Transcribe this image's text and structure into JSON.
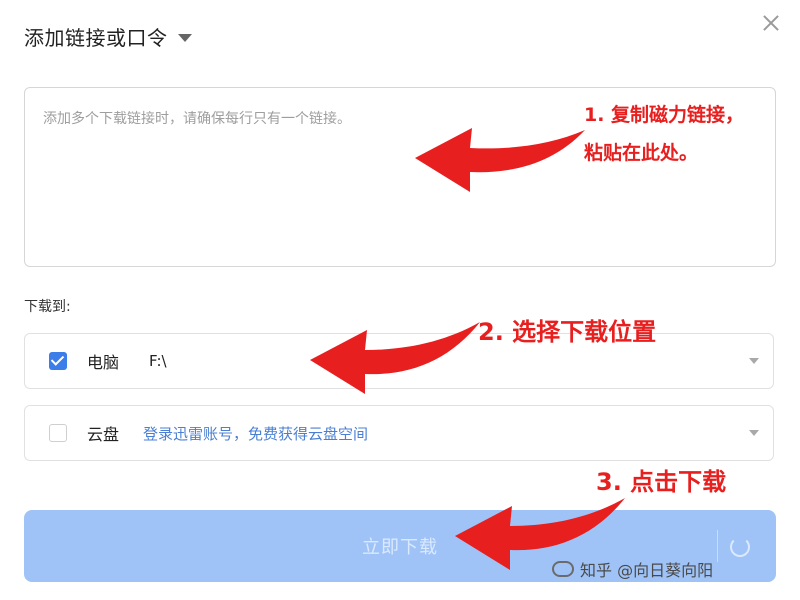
{
  "dialog": {
    "title": "添加链接或口令",
    "textarea_placeholder": "添加多个下载链接时，请确保每行只有一个链接。",
    "download_to_label": "下载到:",
    "pc": {
      "label": "电脑",
      "path": "F:\\",
      "checked": true
    },
    "cloud": {
      "label": "云盘",
      "link_text": "登录迅雷账号，免费获得云盘空间",
      "checked": false
    },
    "download_button_label": "立即下载"
  },
  "annotations": {
    "step1_line1": "1. 复制磁力链接，",
    "step1_line2": "粘贴在此处。",
    "step2": "2. 选择下载位置",
    "step3": "3. 点击下载",
    "color": "#e81f1f"
  },
  "watermark": {
    "text": "知乎 @向日葵向阳"
  },
  "colors": {
    "accent": "#3b7de9",
    "button_disabled": "#9fc3f7",
    "link": "#4a7fd3"
  }
}
